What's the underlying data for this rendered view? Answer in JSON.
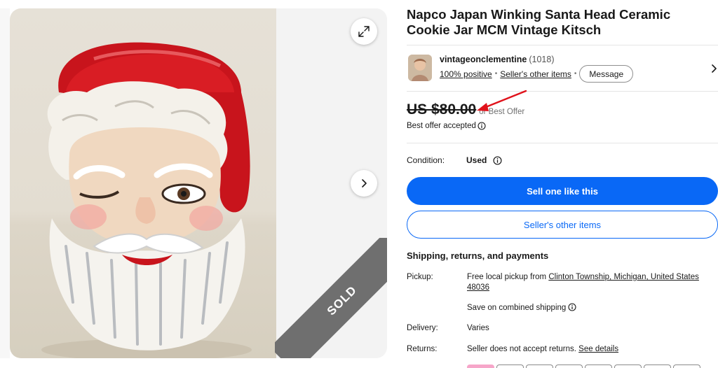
{
  "listing": {
    "title": "Napco Japan Winking Santa Head Ceramic Cookie Jar MCM Vintage Kitsch",
    "sold_overlay": "SOLD"
  },
  "gallery": {
    "expand_icon": "expand-arrows-icon",
    "next_icon": "chevron-right-icon"
  },
  "seller": {
    "name": "vintageonclementine",
    "feedback_count": "(1018)",
    "positive": "100% positive",
    "other_items": "Seller's other items",
    "message_label": "Message"
  },
  "price": {
    "amount": "US $80.00",
    "best_offer": "or Best Offer",
    "offer_accepted": "Best offer accepted"
  },
  "condition": {
    "label": "Condition:",
    "value": "Used"
  },
  "actions": {
    "sell_one": "Sell one like this",
    "sellers_other_items": "Seller's other items"
  },
  "shipping": {
    "heading": "Shipping, returns, and payments",
    "pickup_label": "Pickup:",
    "pickup_prefix": "Free local pickup from ",
    "pickup_location": "Clinton Township, Michigan, United States 48036",
    "combined": "Save on combined shipping",
    "delivery_label": "Delivery:",
    "delivery_value": "Varies",
    "returns_label": "Returns:",
    "returns_value": "Seller does not accept returns. ",
    "see_details": "See details"
  },
  "colors": {
    "primary_blue": "#0968f6",
    "annotation_red": "#e0121b",
    "sold_band": "#6f6f6f"
  }
}
